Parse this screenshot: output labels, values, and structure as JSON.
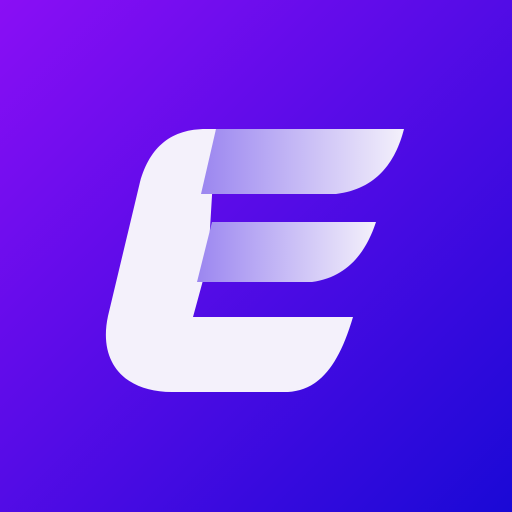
{
  "icon": {
    "name": "E",
    "colors": {
      "background_top_left": "#8a0ef5",
      "background_bottom_right": "#1a09d6",
      "glyph_solid": "#f4f1fb",
      "glyph_bar_fade_start": "#9b86f0",
      "glyph_bar_fade_end": "#f4f1fb"
    }
  }
}
